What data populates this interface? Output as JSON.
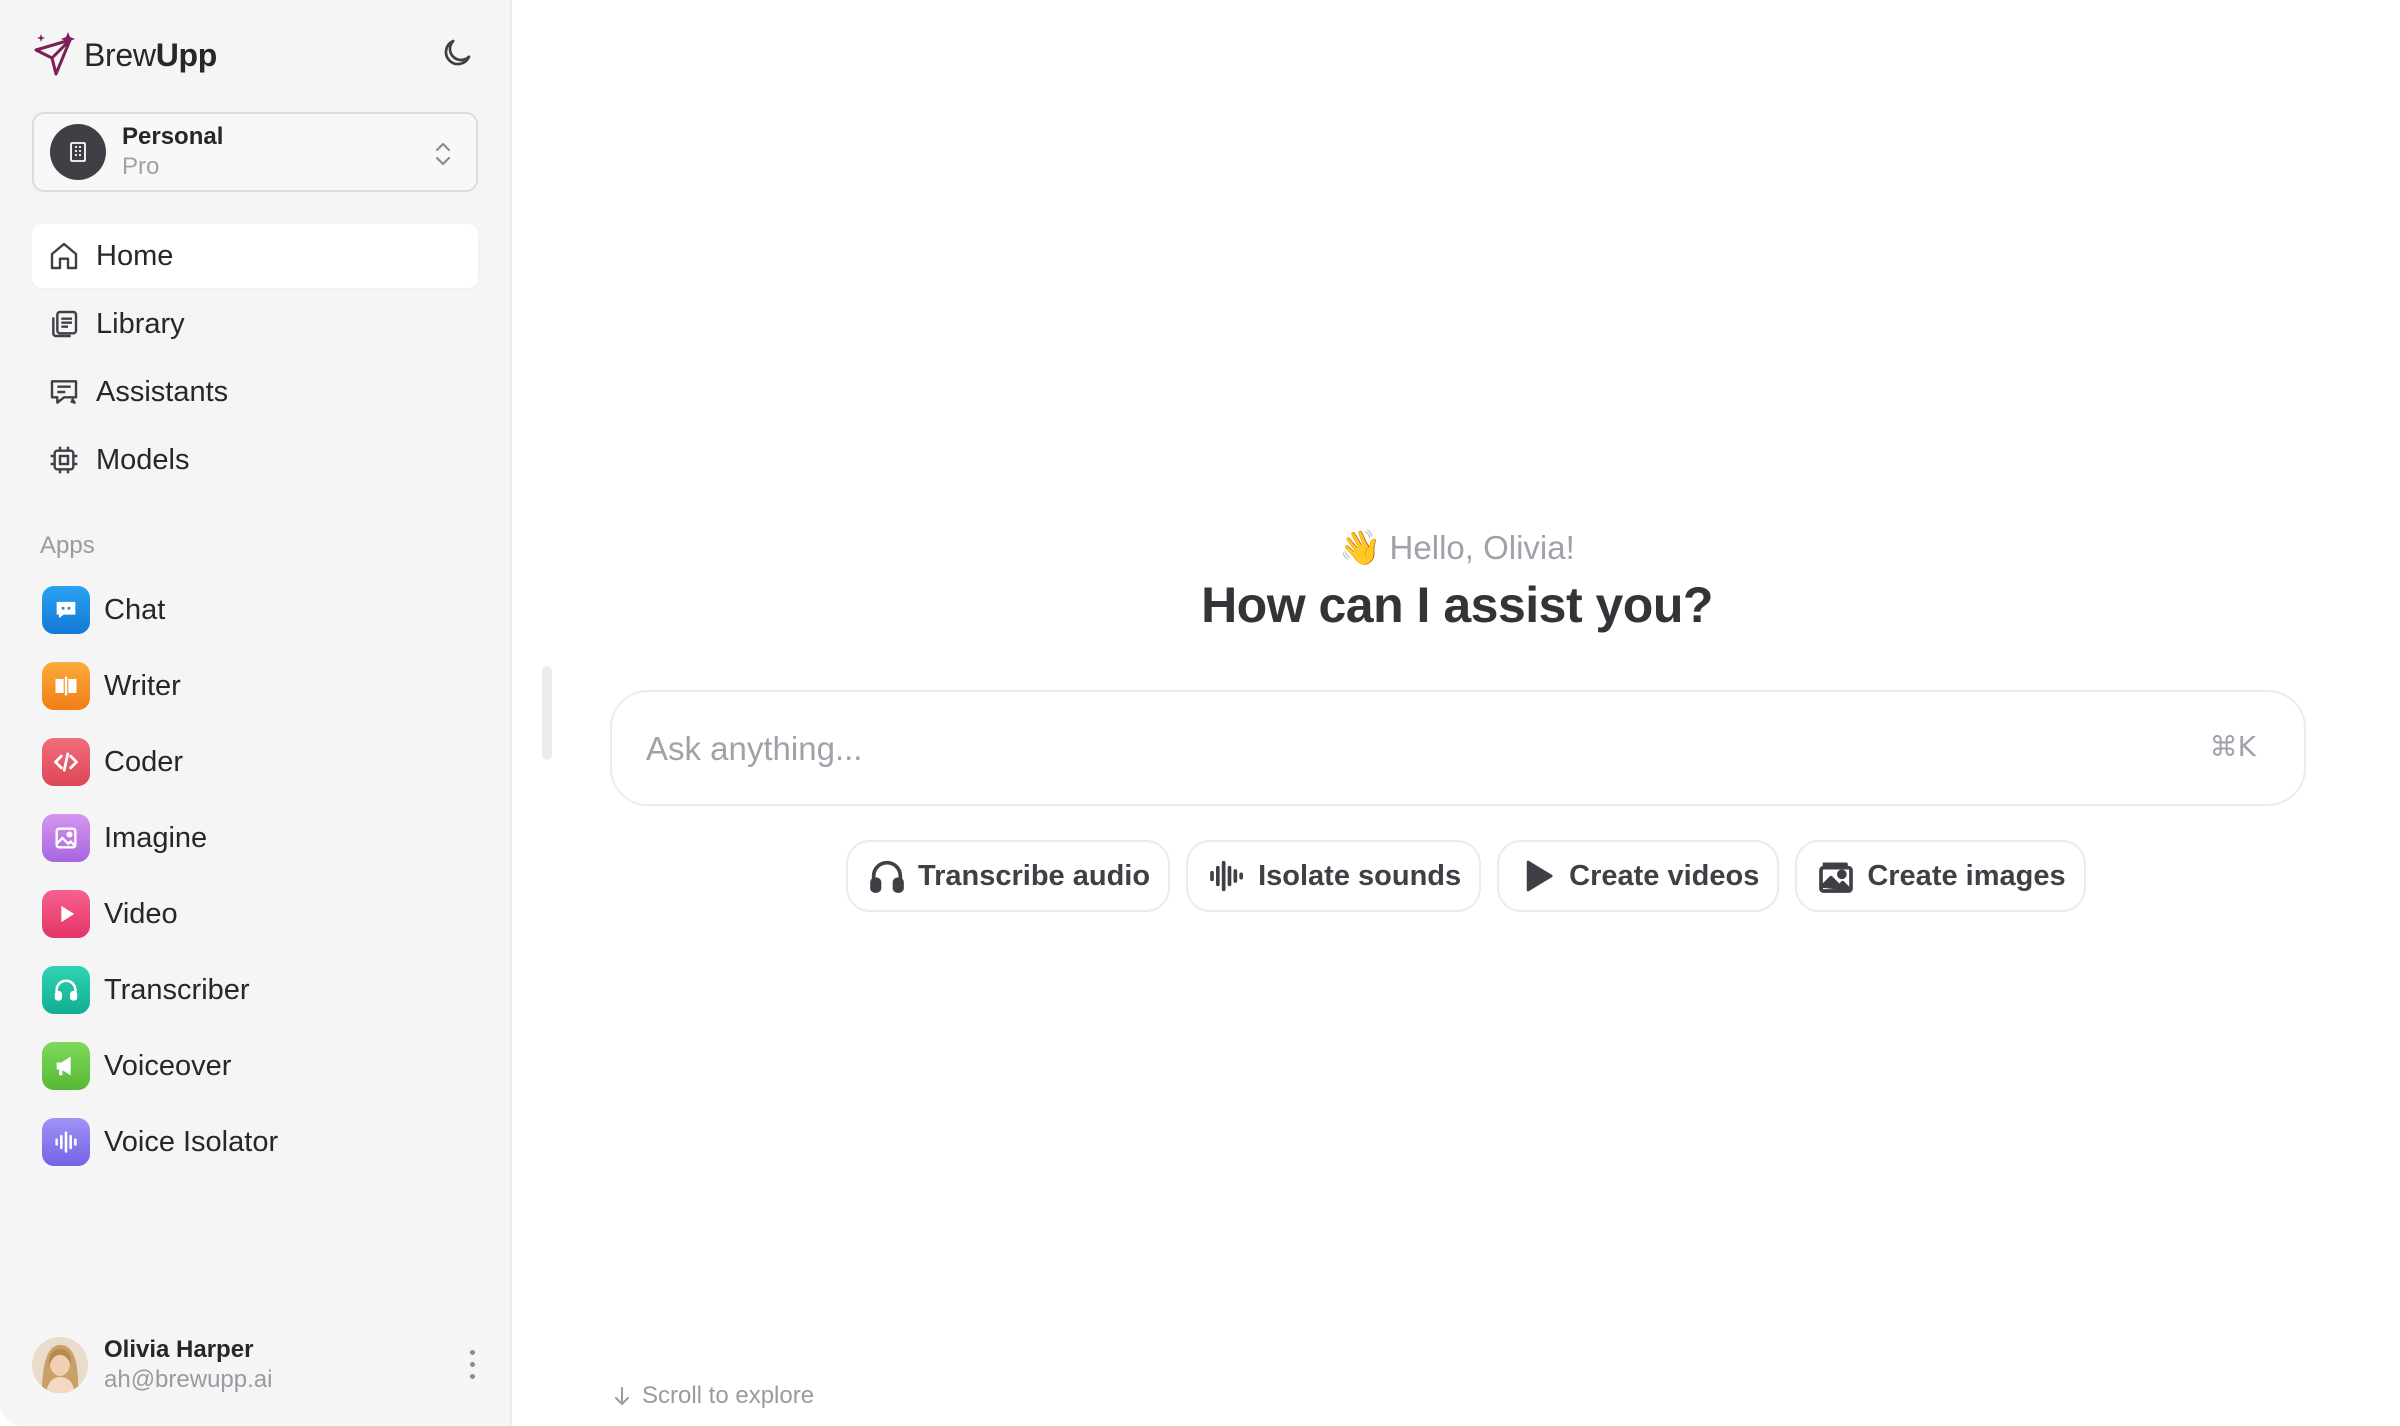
{
  "brand": {
    "name_light": "Brew",
    "name_bold": "Upp",
    "logo_icon": "sparkle-send-icon",
    "logo_color": "#7b1e5a"
  },
  "theme_toggle": {
    "icon": "moon-icon"
  },
  "workspace": {
    "name": "Personal",
    "plan": "Pro",
    "icon": "building-icon",
    "chevron_icon": "chevron-updown-icon"
  },
  "nav": [
    {
      "label": "Home",
      "icon": "home-icon",
      "active": true
    },
    {
      "label": "Library",
      "icon": "library-icon",
      "active": false
    },
    {
      "label": "Assistants",
      "icon": "assistant-chat-icon",
      "active": false
    },
    {
      "label": "Models",
      "icon": "chip-icon",
      "active": false
    }
  ],
  "apps_heading": "Apps",
  "apps": [
    {
      "label": "Chat",
      "icon": "chat-bubble-icon",
      "color": "#1e90e6"
    },
    {
      "label": "Writer",
      "icon": "book-open-icon",
      "color": "#f59524"
    },
    {
      "label": "Coder",
      "icon": "code-icon",
      "color": "#ec5b6a"
    },
    {
      "label": "Imagine",
      "icon": "image-icon",
      "color": "#c77de8"
    },
    {
      "label": "Video",
      "icon": "play-icon",
      "color": "#f0467a"
    },
    {
      "label": "Transcriber",
      "icon": "headphones-icon",
      "color": "#1cc3a5"
    },
    {
      "label": "Voiceover",
      "icon": "megaphone-icon",
      "color": "#6acb4a"
    },
    {
      "label": "Voice Isolator",
      "icon": "waveform-icon",
      "color": "#8b7cf0"
    }
  ],
  "user": {
    "name": "Olivia Harper",
    "email": "ah@brewupp.ai",
    "menu_icon": "more-vertical-icon"
  },
  "main": {
    "greeting": "Hello, Olivia!",
    "greeting_emoji": "👋",
    "headline": "How can I assist you?",
    "search": {
      "placeholder": "Ask anything...",
      "value": "",
      "shortcut": "⌘K"
    },
    "actions": [
      {
        "label": "Transcribe audio",
        "icon": "headphones-icon"
      },
      {
        "label": "Isolate sounds",
        "icon": "waveform-icon"
      },
      {
        "label": "Create videos",
        "icon": "play-icon"
      },
      {
        "label": "Create images",
        "icon": "image-icon"
      }
    ],
    "scroll_hint": "Scroll to explore"
  }
}
